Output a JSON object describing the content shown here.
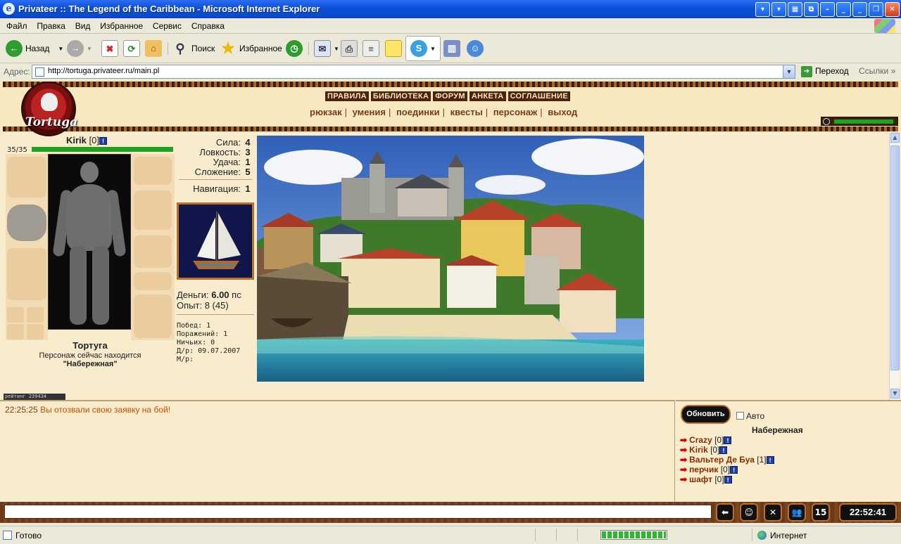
{
  "window": {
    "title": "Privateer :: The Legend of the Caribbean - Microsoft Internet Explorer"
  },
  "menu": [
    "Файл",
    "Правка",
    "Вид",
    "Избранное",
    "Сервис",
    "Справка"
  ],
  "toolbar": {
    "back": "Назад",
    "search": "Поиск",
    "favorites": "Избранное"
  },
  "address": {
    "label": "Адрес:",
    "url": "http://tortuga.privateer.ru/main.pl",
    "go": "Переход",
    "links": "Ссылки"
  },
  "game": {
    "logo_text": "Tortuga",
    "top_nav": [
      "ПРАВИЛА",
      "БИБЛИОТЕКА",
      "ФОРУМ",
      "АНКЕТА",
      "СОГЛАШЕНИЕ"
    ],
    "sub_nav": [
      "рюкзак",
      "умения",
      "поединки",
      "квесты",
      "персонаж",
      "выход"
    ],
    "stamina_fraction": 0.95
  },
  "character": {
    "name": "Kirik",
    "level": "[0]",
    "info": "!",
    "hp": "35/35",
    "hp_fraction": 1.0,
    "city": "Тортуга",
    "location_prefix": "Персонаж сейчас находится",
    "location": "\"Набережная\""
  },
  "stats": [
    {
      "label": "Сила:",
      "value": "4"
    },
    {
      "label": "Ловкость:",
      "value": "3"
    },
    {
      "label": "Удача:",
      "value": "1"
    },
    {
      "label": "Сложение:",
      "value": "5"
    }
  ],
  "navigation": {
    "label": "Навигация:",
    "value": "1"
  },
  "money": {
    "label": "Деньги:",
    "value": "6.00",
    "unit": "пс"
  },
  "experience": {
    "label": "Опыт:",
    "value": "8 (45)"
  },
  "record": [
    "Побед: 1",
    "Поражений: 1",
    "Ничьих: 0",
    "Д/р: 09.07.2007",
    "М/р:"
  ],
  "counter": "рейтинг   239434",
  "chat": {
    "time": "22:25:25",
    "text": "Вы отозвали свою заявку на бой!"
  },
  "users_panel": {
    "refresh": "Обновить",
    "auto": "Авто",
    "room": "Набережная",
    "users": [
      {
        "name": "Crazy",
        "level": "[0]"
      },
      {
        "name": "Kirik",
        "level": "[0]"
      },
      {
        "name": "Вальтер Де Буа",
        "level": "[1]"
      },
      {
        "name": "перчик",
        "level": "[0]"
      },
      {
        "name": "шафт",
        "level": "[0]"
      }
    ]
  },
  "action_bar": {
    "fights_count": "15",
    "clock": "22:52:41"
  },
  "status": {
    "text": "Готово",
    "zone": "Интернет",
    "progress": 1.0
  },
  "colors": {
    "xp_title": "#0b4fd9",
    "wood": "#6d3916",
    "parchment": "#f9eccd",
    "hp": "#1ea41e",
    "chat": "#c84a00"
  }
}
